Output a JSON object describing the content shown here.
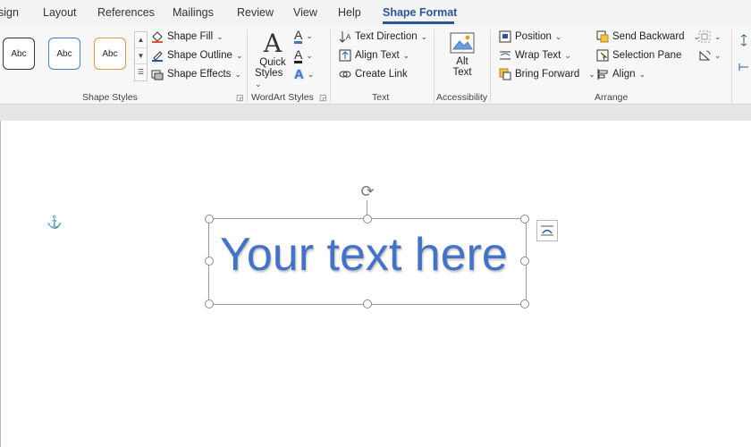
{
  "tabs": [
    {
      "label": "sign"
    },
    {
      "label": "Layout"
    },
    {
      "label": "References"
    },
    {
      "label": "Mailings"
    },
    {
      "label": "Review"
    },
    {
      "label": "View"
    },
    {
      "label": "Help"
    },
    {
      "label": "Shape Format"
    }
  ],
  "active_tab": "Shape Format",
  "shape_styles": {
    "thumbs": [
      "Abc",
      "Abc",
      "Abc"
    ],
    "fill": "Shape Fill",
    "outline": "Shape Outline",
    "effects": "Shape Effects",
    "label": "Shape Styles"
  },
  "wordart": {
    "quick_styles_1": "Quick",
    "quick_styles_2": "Styles",
    "label": "WordArt Styles"
  },
  "text_group": {
    "direction": "Text Direction",
    "align": "Align Text",
    "link": "Create Link",
    "label": "Text"
  },
  "accessibility": {
    "alt_1": "Alt",
    "alt_2": "Text",
    "label": "Accessibility"
  },
  "arrange": {
    "position": "Position",
    "wrap": "Wrap Text",
    "forward": "Bring Forward",
    "backward": "Send Backward",
    "pane": "Selection Pane",
    "align": "Align",
    "label": "Arrange"
  },
  "document": {
    "textbox_text": "Your text here"
  },
  "colors": {
    "accent": "#2b579a",
    "text_blue": "#4472c4"
  }
}
